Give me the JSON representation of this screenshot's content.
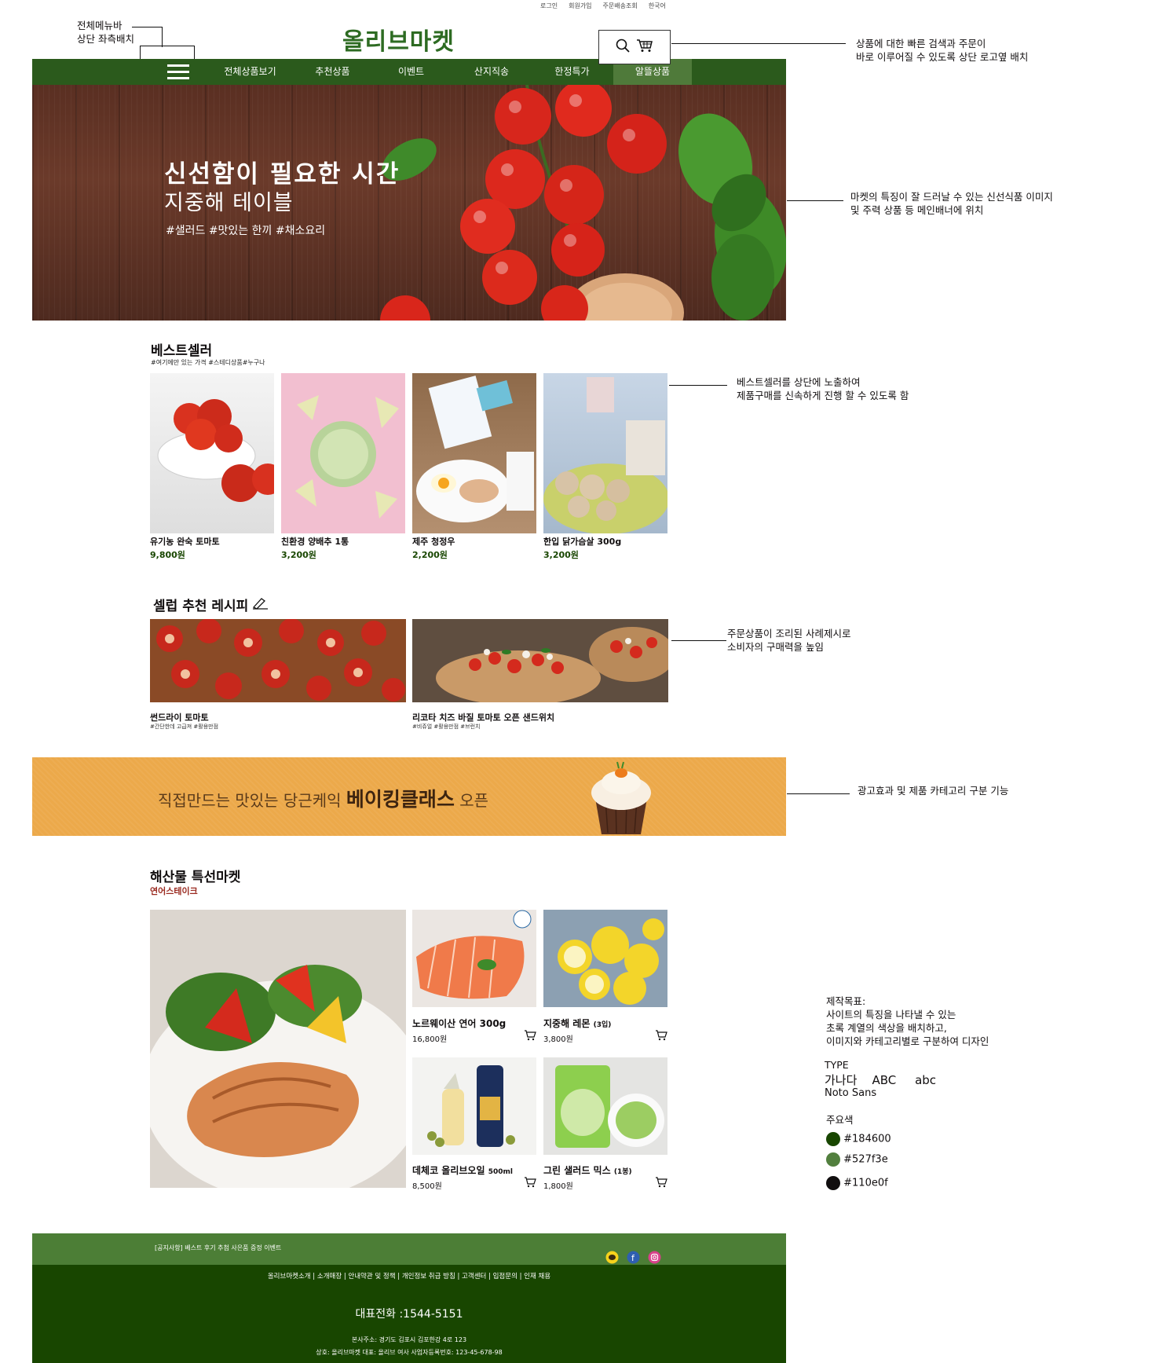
{
  "utility_links": [
    "로그인",
    "회원가입",
    "주문배송조회",
    "한국어"
  ],
  "logo": "올리브마켓",
  "nav": {
    "items": [
      "전체상품보기",
      "추천상품",
      "이벤트",
      "산지직송",
      "한정특가",
      "알뜰상품"
    ]
  },
  "hero": {
    "title": "신선함이 필요한 시간",
    "subtitle": "지중해 테이블",
    "tags": "#샐러드 #맛있는 한끼 #채소요리"
  },
  "bestseller": {
    "title": "베스트셀러",
    "subtitle": "#여기에만 있는 가격 #스테디상품#누구나",
    "products": [
      {
        "name": "유기농 완숙 토마토",
        "price": "9,800원"
      },
      {
        "name": "친환경 양배추 1통",
        "price": "3,200원"
      },
      {
        "name": "제주 청정우",
        "price": "2,200원"
      },
      {
        "name": "한입 닭가슴살 300g",
        "price": "3,200원"
      }
    ]
  },
  "recipes": {
    "title": "셀럽 추천 레시피",
    "items": [
      {
        "name": "썬드라이 토마토",
        "tags": "#간단한데 고급져 #활용만점"
      },
      {
        "name": "리코타 치즈 바질 토마토 오픈 샌드위치",
        "tags": "#비쥬얼 #활용만점 #브런치"
      }
    ]
  },
  "banner": {
    "prefix": "직접만드는 맛있는 당근케익",
    "highlight": "베이킹클래스",
    "suffix": "오픈"
  },
  "seafood": {
    "title": "해산물 특선마켓",
    "subtitle": "연어스테이크",
    "products": [
      {
        "name": "노르웨이산 연어 300g",
        "price": "16,800원"
      },
      {
        "name": "지중해 레몬",
        "unit": "(3입)",
        "price": "3,800원"
      },
      {
        "name": "데체코 올리브오일",
        "unit": "500ml",
        "price": "8,500원"
      },
      {
        "name": "그린 샐러드 믹스",
        "unit": "(1봉)",
        "price": "1,800원"
      }
    ]
  },
  "footer": {
    "notice": "[공지사항] 베스트 후기 추첨 사은품 증정 이벤트",
    "links": "올리브마켓소개 | 소개매장 | 안내약관 및 정책 | 개인정보 취급 방침 | 고객센터 | 입점문의 | 인재 채용",
    "phone": "대표전화 :1544-5151",
    "address": "본사주소: 경기도 김포시 김포한강 4로  123",
    "company": "상호: 올리브마켓   대표: 올리브 여사   사업자등록번호: 123-45-678-98"
  },
  "annotations": {
    "menu": "전체메뉴바\n상단 좌측배치",
    "search": "상품에 대한 빠른 검색과 주문이\n바로 이루어질 수 있도록 상단 로고옆 배치",
    "hero": "마켓의 특징이 잘 드러날 수 있는 신선식품 이미지\n및 주력 상품 등 메인배너에 위치",
    "bestseller": "베스트셀러를 상단에 노출하여\n제품구매를 신속하게 진행 할 수 있도록 함",
    "recipe": "주문상품이 조리된 사례제시로\n소비자의 구매력을 높임",
    "banner": "광고효과 및 제품 카테고리 구분 기능",
    "goal": "제작목표:\n사이트의 특징을 나타낼 수 있는\n초록 계열의 색상을 배치하고,\n이미지와 카테고리별로 구분하여 디자인",
    "type_label": "TYPE",
    "type_sample": "가나다    ABC     abc",
    "type_font": "Noto Sans",
    "colors_label": "주요색"
  },
  "colors": {
    "primary": "#184600",
    "secondary": "#527f3e",
    "text": "#110e0f"
  },
  "color_labels": [
    "#184600",
    "#527f3e",
    "#110e0f"
  ]
}
